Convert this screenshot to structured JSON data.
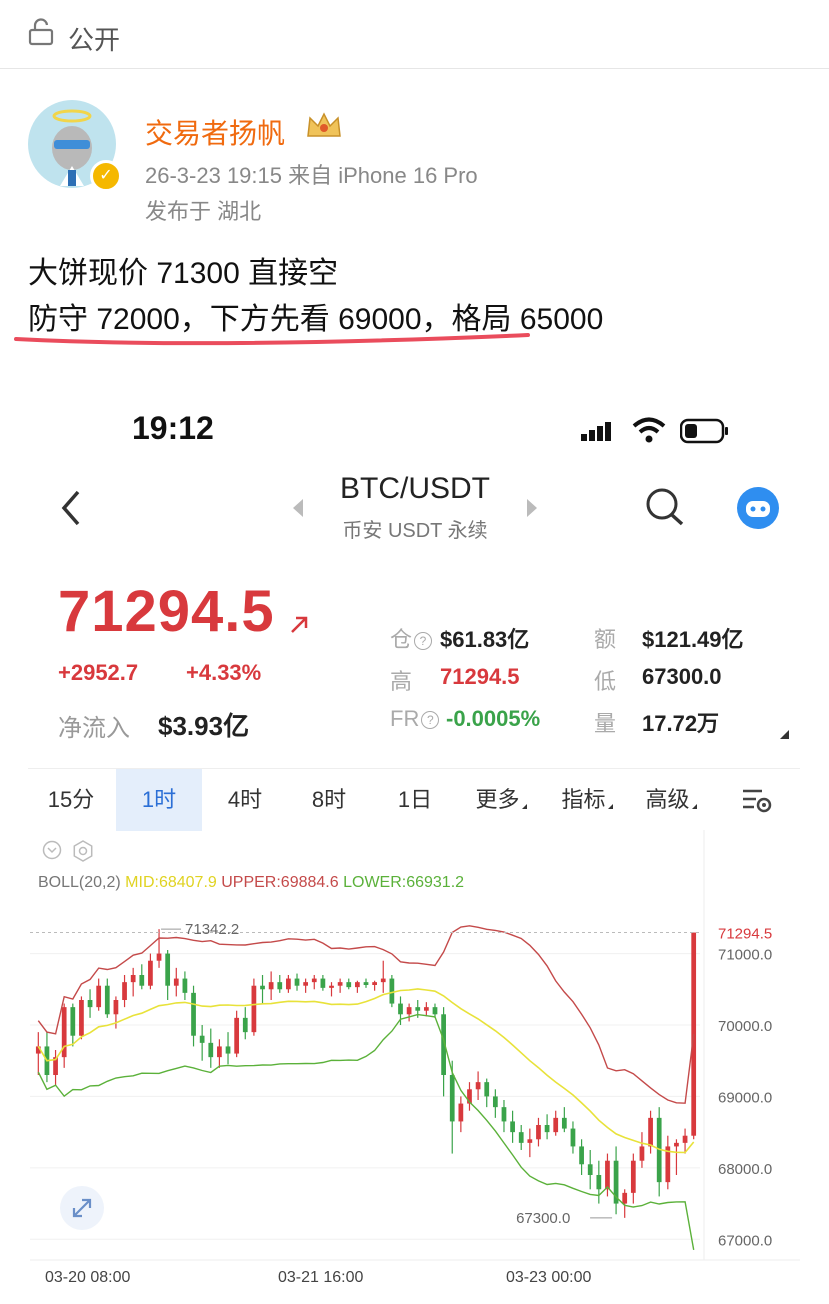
{
  "weibo": {
    "visibility": "公开",
    "username": "交易者扬帆",
    "meta": "26-3-23 19:15  来自 iPhone 16 Pro",
    "location": "发布于 湖北",
    "line1": "大饼现价 71300 直接空",
    "line2": "防守 72000，下方先看 69000，格局 65000"
  },
  "status_bar": {
    "time": "19:12"
  },
  "nav": {
    "pair": "BTC/USDT",
    "subtitle": "币安 USDT 永续"
  },
  "ticker": {
    "price": "71294.5",
    "change_abs": "+2952.7",
    "change_pct": "+4.33%",
    "netflow_label": "净流入",
    "netflow_value": "$3.93亿",
    "stats": {
      "oi_label": "仓",
      "oi_value": "$61.83亿",
      "vol_label": "额",
      "vol_value": "$121.49亿",
      "high_label": "高",
      "high_value": "71294.5",
      "low_label": "低",
      "low_value": "67300.0",
      "fr_label": "FR",
      "fr_value": "-0.0005%",
      "qty_label": "量",
      "qty_value": "17.72万"
    }
  },
  "tabs": [
    "15分",
    "1时",
    "4时",
    "8时",
    "1日",
    "更多",
    "指标",
    "高级"
  ],
  "active_tab": "1时",
  "colors": {
    "up": "#d8393d",
    "down": "#3aa34a",
    "mid": "#e8e23a",
    "upper": "#c44a4a",
    "lower": "#5bb13a"
  },
  "chart_data": {
    "type": "candlestick",
    "indicator": {
      "name": "BOLL(20,2)",
      "mid_label": "MID:68407.9",
      "upper_label": "UPPER:69884.6",
      "lower_label": "LOWER:66931.2"
    },
    "y_ticks": [
      "71000.0",
      "70000.0",
      "69000.0",
      "68000.0",
      "67000.0"
    ],
    "y_range": [
      66850,
      71750
    ],
    "x_ticks": [
      "03-20 08:00",
      "03-21 16:00",
      "03-23 00:00"
    ],
    "last_price_label": "71294.5",
    "high_marker": "71342.2",
    "low_marker": "67300.0",
    "candles": [
      [
        69600,
        69900,
        69300,
        69700
      ],
      [
        69700,
        69900,
        69200,
        69300
      ],
      [
        69300,
        69650,
        69150,
        69550
      ],
      [
        69550,
        70300,
        69400,
        70250
      ],
      [
        70250,
        70300,
        69700,
        69850
      ],
      [
        69850,
        70400,
        69800,
        70350
      ],
      [
        70350,
        70500,
        70100,
        70250
      ],
      [
        70250,
        70650,
        70200,
        70550
      ],
      [
        70550,
        70650,
        70100,
        70150
      ],
      [
        70150,
        70400,
        69950,
        70350
      ],
      [
        70350,
        70700,
        70250,
        70600
      ],
      [
        70600,
        70800,
        70400,
        70700
      ],
      [
        70700,
        70850,
        70500,
        70550
      ],
      [
        70550,
        71000,
        70500,
        70900
      ],
      [
        70900,
        71342,
        70800,
        71000
      ],
      [
        71000,
        71050,
        70350,
        70550
      ],
      [
        70550,
        70800,
        70400,
        70650
      ],
      [
        70650,
        70750,
        70350,
        70450
      ],
      [
        70450,
        70550,
        69700,
        69850
      ],
      [
        69850,
        70000,
        69500,
        69750
      ],
      [
        69750,
        69950,
        69400,
        69550
      ],
      [
        69550,
        69800,
        69400,
        69700
      ],
      [
        69700,
        69900,
        69450,
        69600
      ],
      [
        69600,
        70200,
        69550,
        70100
      ],
      [
        70100,
        70250,
        69800,
        69900
      ],
      [
        69900,
        70650,
        69850,
        70550
      ],
      [
        70550,
        70700,
        70300,
        70500
      ],
      [
        70500,
        70750,
        70350,
        70600
      ],
      [
        70600,
        70700,
        70450,
        70500
      ],
      [
        70500,
        70700,
        70450,
        70650
      ],
      [
        70650,
        70720,
        70480,
        70550
      ],
      [
        70550,
        70650,
        70450,
        70600
      ],
      [
        70600,
        70700,
        70500,
        70650
      ],
      [
        70650,
        70700,
        70480,
        70520
      ],
      [
        70520,
        70600,
        70400,
        70550
      ],
      [
        70550,
        70650,
        70450,
        70600
      ],
      [
        70600,
        70650,
        70500,
        70530
      ],
      [
        70530,
        70620,
        70450,
        70600
      ],
      [
        70600,
        70650,
        70520,
        70560
      ],
      [
        70560,
        70620,
        70480,
        70600
      ],
      [
        70600,
        70900,
        70450,
        70650
      ],
      [
        70650,
        70700,
        70250,
        70300
      ],
      [
        70300,
        70400,
        70000,
        70150
      ],
      [
        70150,
        70300,
        70050,
        70250
      ],
      [
        70250,
        70350,
        70100,
        70200
      ],
      [
        70200,
        70320,
        70120,
        70250
      ],
      [
        70250,
        70300,
        70100,
        70150
      ],
      [
        70150,
        70250,
        69000,
        69300
      ],
      [
        69300,
        69500,
        68200,
        68650
      ],
      [
        68650,
        69000,
        68500,
        68900
      ],
      [
        68900,
        69200,
        68800,
        69100
      ],
      [
        69100,
        69350,
        68950,
        69200
      ],
      [
        69200,
        69250,
        68850,
        69000
      ],
      [
        69000,
        69100,
        68700,
        68850
      ],
      [
        68850,
        68950,
        68500,
        68650
      ],
      [
        68650,
        68800,
        68350,
        68500
      ],
      [
        68500,
        68600,
        68250,
        68350
      ],
      [
        68350,
        68550,
        68150,
        68400
      ],
      [
        68400,
        68700,
        68300,
        68600
      ],
      [
        68600,
        68750,
        68400,
        68500
      ],
      [
        68500,
        68800,
        68450,
        68700
      ],
      [
        68700,
        68850,
        68500,
        68550
      ],
      [
        68550,
        68650,
        68200,
        68300
      ],
      [
        68300,
        68400,
        67900,
        68050
      ],
      [
        68050,
        68250,
        67700,
        67900
      ],
      [
        67900,
        68100,
        67500,
        67700
      ],
      [
        67700,
        68200,
        67600,
        68100
      ],
      [
        68100,
        68300,
        67350,
        67500
      ],
      [
        67500,
        67700,
        67300,
        67650
      ],
      [
        67650,
        68200,
        67500,
        68100
      ],
      [
        68100,
        68500,
        68000,
        68300
      ],
      [
        68300,
        68800,
        68200,
        68700
      ],
      [
        68700,
        68850,
        67600,
        67800
      ],
      [
        67800,
        68450,
        67700,
        68300
      ],
      [
        68300,
        68400,
        67900,
        68350
      ],
      [
        68350,
        68550,
        68200,
        68450
      ],
      [
        68450,
        71294,
        68400,
        71294
      ]
    ]
  }
}
